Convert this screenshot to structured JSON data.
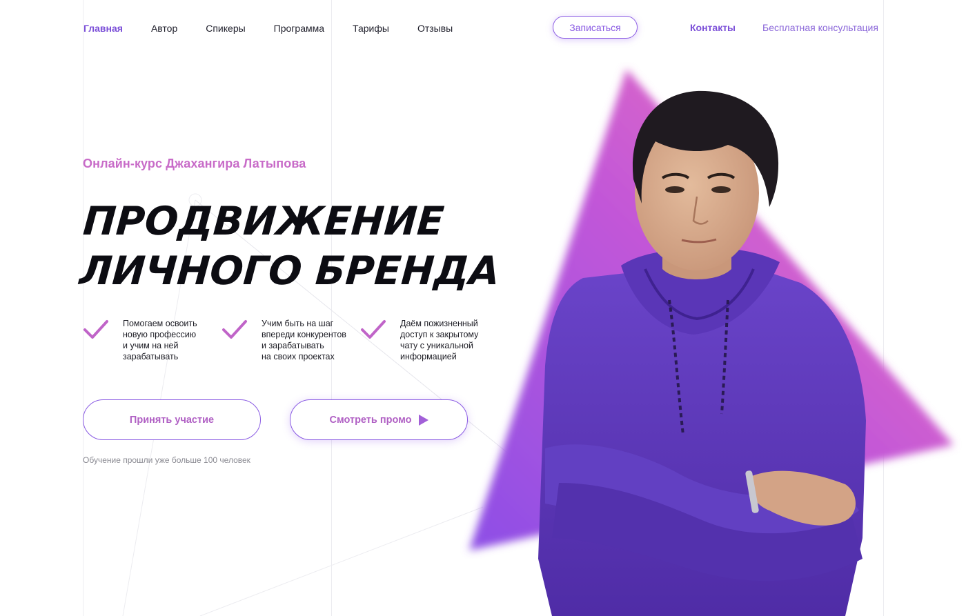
{
  "nav": {
    "items": [
      {
        "label": "Главная",
        "active": true
      },
      {
        "label": "Автор",
        "active": false
      },
      {
        "label": "Спикеры",
        "active": false
      },
      {
        "label": "Программа",
        "active": false
      },
      {
        "label": "Тарифы",
        "active": false
      },
      {
        "label": "Отзывы",
        "active": false
      }
    ],
    "signup_label": "Записаться",
    "contacts_label": "Контакты",
    "consult_label": "Бесплатная консультация"
  },
  "hero": {
    "subtitle": "Онлайн-курс Джахангира Латыпова",
    "title_line1": "ПРОДВИЖЕНИЕ",
    "title_line2": "ЛИЧНОГО БРЕНДА",
    "features": [
      {
        "text": "Помогаем освоить\nновую профессию\nи учим на ней\nзарабатывать",
        "icon": "check-icon"
      },
      {
        "text": "Учим быть на шаг\nвпереди конкурентов\nи зарабатывать\nна своих проектах",
        "icon": "check-icon"
      },
      {
        "text": "Даём пожизненный\nдоступ к закрытому\nчату с уникальной\nинформацией",
        "icon": "check-icon"
      }
    ],
    "join_label": "Принять участие",
    "promo_label": "Смотреть промо",
    "students_note": "Обучение прошли уже больше 100 человек"
  },
  "colors": {
    "accent": "#7b4fd8",
    "pink": "#c86bc8",
    "triangle_start": "#9b4fe0",
    "triangle_end": "#f06fb8",
    "hoodie": "#5b35b8"
  }
}
